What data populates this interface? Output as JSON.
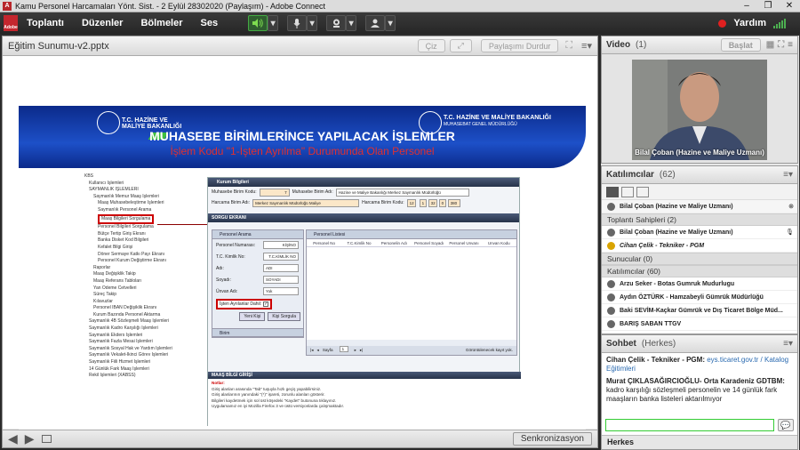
{
  "window": {
    "title": "Kamu Personel Harcamaları Yönt. Sist. - 2 Eylül 28302020 (Paylaşım) - Adobe Connect",
    "controls": [
      "–",
      "❐",
      "✕"
    ]
  },
  "menubar": {
    "brand": "Adobe",
    "items": [
      "Toplantı",
      "Düzenler",
      "Bölmeler",
      "Ses"
    ],
    "help": "Yardım"
  },
  "share_pod": {
    "title": "Eğitim Sunumu-v2.pptx",
    "draw_label": "Çiz",
    "stop_label": "Paylaşımı Durdur",
    "sync_label": "Senkronizasyon"
  },
  "slide": {
    "logo_left": "T.C. HAZİNE VE MALİYE BAKANLIĞI",
    "logo_right_1": "T.C. HAZİNE VE MALİYE BAKANLIĞI",
    "logo_right_2": "MUHASEBAT GENEL MÜDÜRLÜĞÜ",
    "title": "MUHASEBE BİRİMLERİNCE YAPILACAK İŞLEMLER",
    "subtitle": "İşlem Kodu \"1-İşten Ayrılma\" Durumunda Olan Personel",
    "tree": [
      "KBS",
      "Kullanıcı İşlemleri",
      "SAYMANLIK İŞLEMLERİ",
      "Saymanlık Memur Maaş İşlemleri",
      "Maaş Muhasebeleştirme İşlemleri",
      "Saymanlık Personel Arama",
      "Maaş Bilgileri Sorgulama",
      "Personel Bilgileri Sorgulama",
      "Bütçe Tertip Giriş Ekranı",
      "Banka Disket Kod Bilgileri",
      "Kefalet Bilgi Girişi",
      "Döner Sermaye Katkı Payı Ekranı",
      "Personel Kurum Değiştirme Ekranı",
      "Raporlar",
      "Maaş Değişiklik Takip",
      "Maaş Referans Tabloları",
      "Yan Ödeme Cetvelleri",
      "Süreç Takip",
      "Kılavuzlar",
      "Personel IBAN Değişiklik Ekranı",
      "Kurum Bazında Personel Aktarma",
      "Saymanlık 4B Sözleşmeli Maaş İşlemleri",
      "Saymanlık Kadro Karşılığı İşlemleri",
      "Saymanlık Ekders İşlemleri",
      "Saymanlık Fazla Mesai İşlemleri",
      "Saymanlık Sosyal Hak ve Yardım İşlemleri",
      "Saymanlık Vekalet-İkinci Görev İşlemleri",
      "Saymanlık Fiili Hizmet İşlemleri",
      "14 Günlük Fark Maaş İşlemleri",
      "Rekil İşlemleri (XABSS)"
    ],
    "form": {
      "kurum_header": "Kurum Bilgileri",
      "kurum_kodu_label": "Muhasebe Birim Kodu:",
      "kurum_kodu": "7",
      "kurum_adi_label": "Muhasebe Birim Adı:",
      "kurum_adi": "Hazine ve Maliye Bakanlığı Merkez Saymanlık Müdürlüğü",
      "harcama_adi_label": "Harcama Birim Adı:",
      "harcama_adi": "Merkez Saymanlık Müdürlüğü Maliye",
      "harcama_kodu_label": "Harcama Birim Kodu:",
      "harcama_kodu": [
        "12",
        "1",
        "32",
        "0",
        "380"
      ],
      "sorgu_header": "SORGU EKRANI",
      "personel_arama": "Personel Arama",
      "personel_no_label": "Personel Numarası:",
      "personel_no": "KİŞİNO",
      "tckimlik_label": "T.C. Kimlik No:",
      "tckimlik": "T.C.KİMLİK NO",
      "adi_label": "Adı:",
      "adi": "ADI",
      "soyadi_label": "Soyadı:",
      "soyadi": "SOYADI",
      "unvan_label": "Ünvan Adı:",
      "unvan": "Yok",
      "isten_ayrilanlar": "İşten Ayrılanlar Dahil:",
      "yeni_kisi": "Yeni Kişi",
      "kisi_sorgula": "Kişi Sorgula",
      "birim": "Birim",
      "personel_listesi": "Personel Listesi",
      "list_columns": [
        "Personel No",
        "T.C.Kimlik No",
        "Personelin Adı",
        "Personel Soyadı",
        "Personel Unvanı",
        "Unvan Kodu"
      ],
      "pager_label": "Sayfa",
      "pager_page": "1",
      "pager_info": "Görüntülenecek kayıt yok.",
      "notice_header": "MAAŞ BİLGİ GİRİŞİ",
      "notice_title": "Notlar:",
      "notice_lines": [
        "Giriş alanları arasında \"Tab\" tuşuyla hızlı geçiş yapabilirsiniz.",
        "Giriş alanlarının yanındaki \"(*)\" işareti, zorunlu alanları gösterir.",
        "Bilgileri kaydetmek için sol üst köşedeki \"Kaydet\" butonuna tıklayınız.",
        "Uygulamamız en iyi Mozilla Firefox 3 ve üstü versiyonlarda çalışmaktadır."
      ]
    }
  },
  "video_pod": {
    "title": "Video",
    "count": "(1)",
    "start_label": "Başlat",
    "caption": "Bilal Çoban (Hazine ve Maliye Uzmanı)"
  },
  "attendees_pod": {
    "title": "Katılımcılar",
    "count": "(62)",
    "current_user": "Bilal Çoban (Hazine ve Maliye Uzmanı)",
    "hosts_group": "Toplantı Sahipleri (2)",
    "hosts": [
      "Bilal Çoban (Hazine ve Maliye Uzmanı)",
      "Cihan Çelik - Tekniker - PGM"
    ],
    "presenters_group": "Sunucular (0)",
    "participants_group": "Katılımcılar (60)",
    "participants": [
      "Arzu Seker - Botas Gumruk Mudurlugu",
      "Aydın ÖZTÜRK - Hamzabeyli Gümrük Müdürlüğü",
      "Baki SEVİM-Kaçkar Gümrük ve Dış Ticaret Bölge Müd...",
      "BARIŞ SABAN TTGV"
    ]
  },
  "chat_pod": {
    "title": "Sohbet",
    "count": "(Herkes)",
    "messages": [
      {
        "author": "Cihan Çelik - Tekniker - PGM:",
        "text": "eys.ticaret.gov.tr / Katalog Eğitimleri"
      },
      {
        "author": "Murat ÇIKLASAĞIRCIOĞLU- Orta Karadeniz GDTBM:",
        "text": "kadro karşılığı sözleşmeli personelin ve 14 günlük fark maaşların banka listeleri aktarılmıyor"
      }
    ],
    "recipient": "Herkes"
  },
  "colors": {
    "menubar": "#2e2e2e",
    "slide_banner": "#1d50c8",
    "highlight_red": "#cc0000",
    "link_blue": "#2a6ab0"
  }
}
